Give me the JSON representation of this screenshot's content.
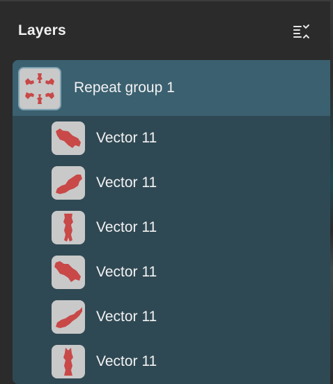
{
  "panel": {
    "title": "Layers",
    "menu_icon": "collapse-expand-list-icon"
  },
  "group": {
    "label": "Repeat group 1",
    "thumb_icon": "repeat-group-thumbnail-icon"
  },
  "children": [
    {
      "label": "Vector 11",
      "thumb_icon": "vector-shape-thumbnail-icon"
    },
    {
      "label": "Vector 11",
      "thumb_icon": "vector-shape-thumbnail-icon"
    },
    {
      "label": "Vector 11",
      "thumb_icon": "vector-shape-thumbnail-icon"
    },
    {
      "label": "Vector 11",
      "thumb_icon": "vector-shape-thumbnail-icon"
    },
    {
      "label": "Vector 11",
      "thumb_icon": "vector-shape-thumbnail-icon"
    },
    {
      "label": "Vector 11",
      "thumb_icon": "vector-shape-thumbnail-icon"
    }
  ],
  "colors": {
    "panel_bg": "#2b2b2b",
    "tree_bg": "#2f4954",
    "selected_row_bg": "#3b6070",
    "thumbnail_bg": "#c9c9c9",
    "shape_red": "#c94848",
    "text": "#f2f2f2"
  }
}
